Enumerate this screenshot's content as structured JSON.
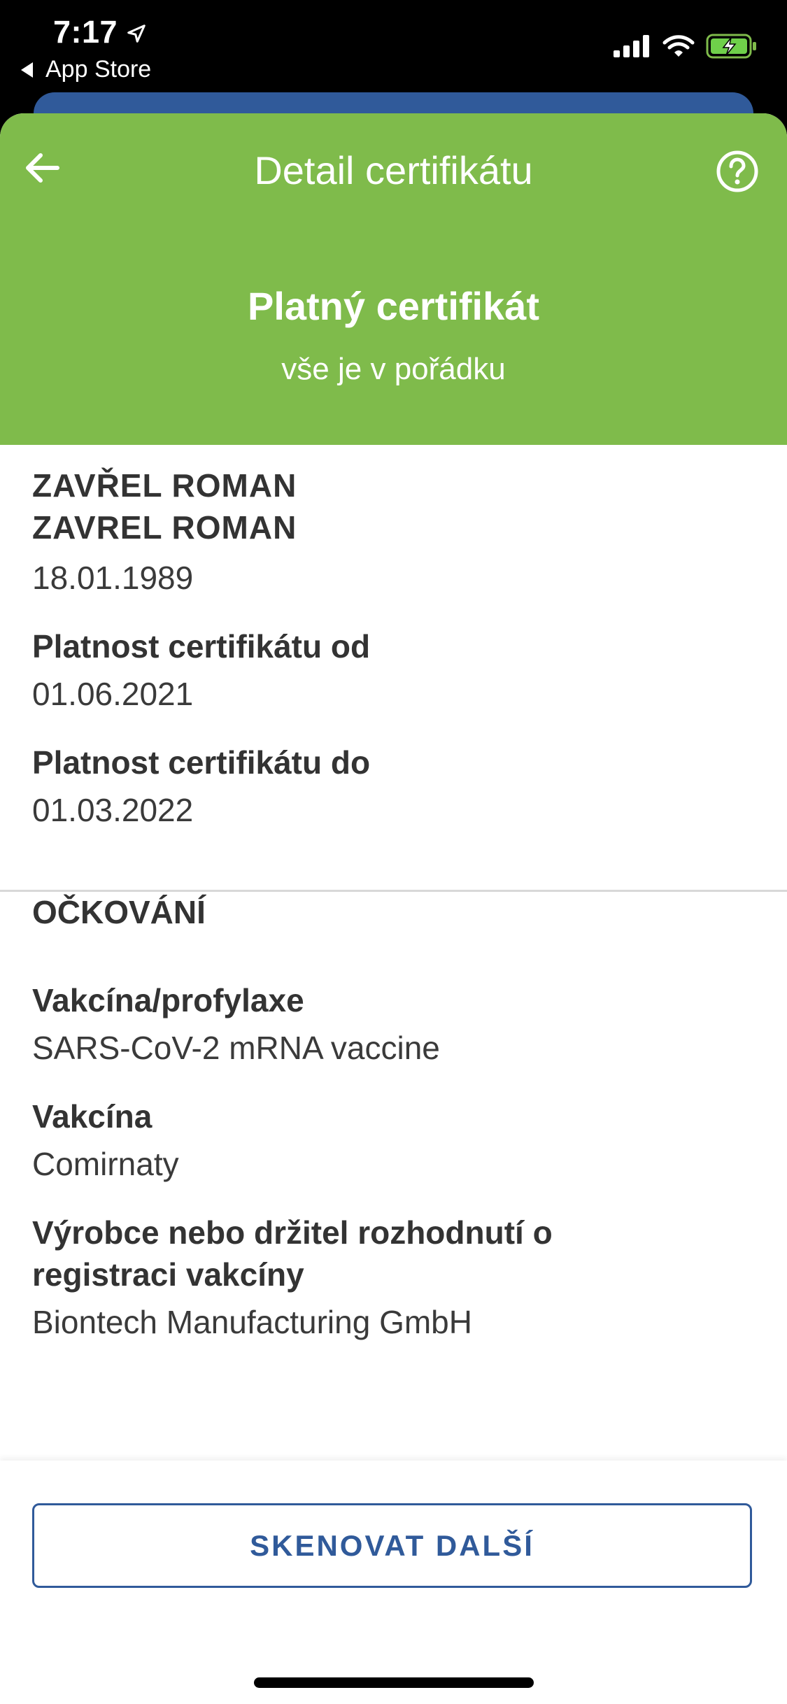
{
  "status_bar": {
    "time": "7:17",
    "back_app": "App Store"
  },
  "header": {
    "title": "Detail certifikátu",
    "status_title": "Platný certifikát",
    "status_subtitle": "vše je v pořádku",
    "color": "#7fbb4b"
  },
  "holder": {
    "name_line1": "ZAVŘEL ROMAN",
    "name_line2": "ZAVREL ROMAN",
    "birth_date": "18.01.1989"
  },
  "validity": {
    "from_label": "Platnost certifikátu od",
    "from_value": "01.06.2021",
    "to_label": "Platnost certifikátu do",
    "to_value": "01.03.2022"
  },
  "vaccination": {
    "section_title": "OČKOVÁNÍ",
    "prophylaxis_label": "Vakcína/profylaxe",
    "prophylaxis_value": "SARS-CoV-2 mRNA vaccine",
    "vaccine_label": "Vakcína",
    "vaccine_value": "Comirnaty",
    "manufacturer_label_line1": "Výrobce nebo držitel rozhodnutí o",
    "manufacturer_label_line2": "registraci vakcíny",
    "manufacturer_value": "Biontech Manufacturing GmbH"
  },
  "actions": {
    "scan_next": "SKENOVAT DALŠÍ",
    "accent": "#305a9a"
  },
  "icons": {
    "location": "location-arrow-icon",
    "signal": "cellular-signal-icon",
    "wifi": "wifi-icon",
    "battery": "battery-charging-icon",
    "back": "back-arrow-icon",
    "help": "help-icon"
  }
}
